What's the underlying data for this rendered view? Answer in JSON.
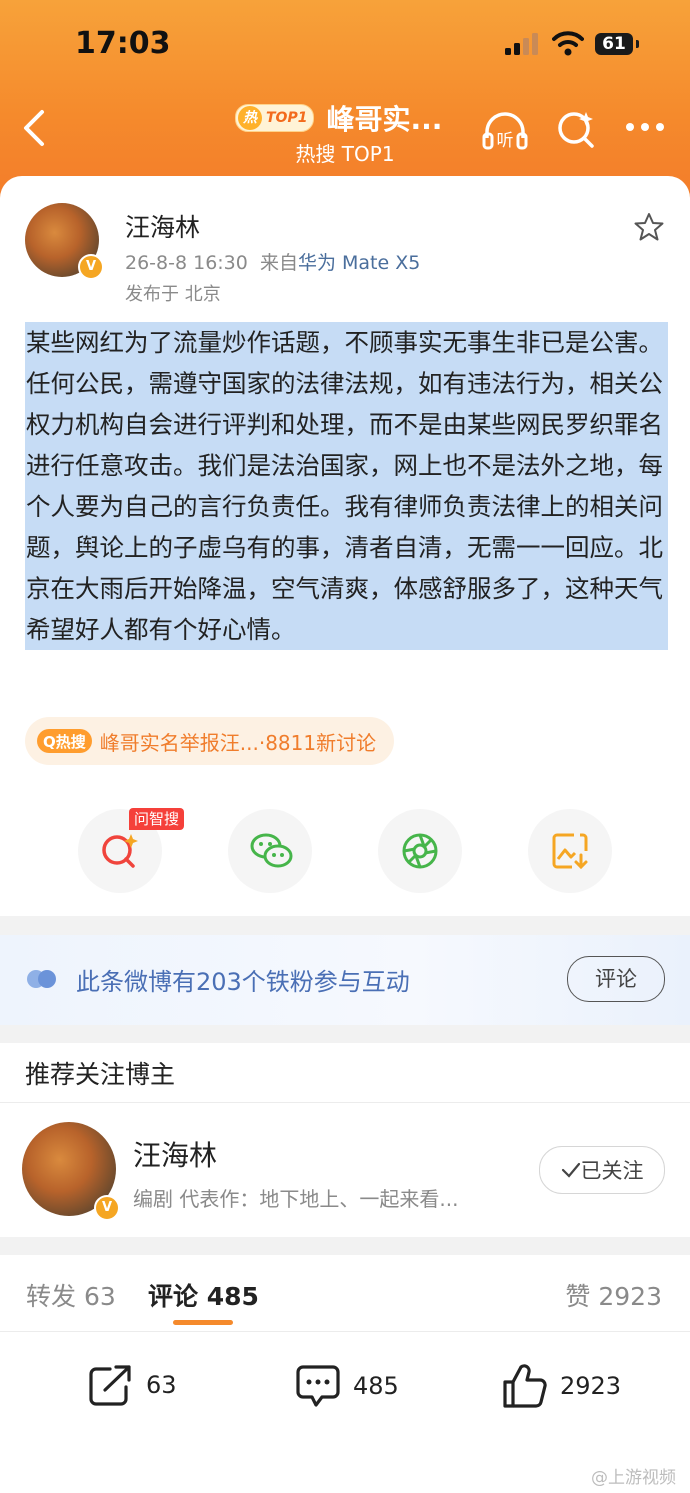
{
  "status_bar": {
    "time": "17:03",
    "battery": "61"
  },
  "nav": {
    "hot_badge": "热",
    "hot_rank": "TOP1",
    "title": "峰哥实...",
    "subtitle": "热搜 TOP1",
    "icons": [
      "back-arrow-icon",
      "headphones-listen-icon",
      "ai-search-icon",
      "more-icon"
    ]
  },
  "post": {
    "author": "汪海林",
    "date": "26-8-8 16:30",
    "source_prefix": "来自",
    "source_device": "华为 Mate X5",
    "location": "发布于 北京",
    "text": "某些网红为了流量炒作话题，不顾事实无事生非已是公害。任何公民，需遵守国家的法律法规，如有违法行为，相关公权力机构自会进行评判和处理，而不是由某些网民罗织罪名进行任意攻击。我们是法治国家，网上也不是法外之地，每个人要为自己的言行负责任。我有律师负责法律上的相关问题，舆论上的子虚乌有的事，清者自清，无需一一回应。北京在大雨后开始降温，空气清爽，体感舒服多了，这种天气希望好人都有个好心情。",
    "topic_tag": "Q热搜",
    "topic": "峰哥实名举报汪...·8811新讨论",
    "share_ai_tag": "问智搜",
    "share_icons": [
      "ai-search-icon",
      "wechat-icon",
      "moments-icon",
      "save-image-icon"
    ]
  },
  "fans": {
    "text": "此条微博有203个铁粉参与互动",
    "button": "评论"
  },
  "recommend": {
    "heading": "推荐关注博主",
    "name": "汪海林",
    "desc": "编剧  代表作：地下地上、一起来看...",
    "follow": "已关注"
  },
  "tabs": {
    "repost": "转发 63",
    "comment": "评论 485",
    "like": "赞 2923"
  },
  "actions": {
    "repost": "63",
    "comment": "485",
    "like": "2923"
  },
  "watermark": "@上游视频",
  "colors": {
    "header_orange": "#f58a2c",
    "highlight_blue": "#c6dcf5",
    "topic_orange": "#f07d2c",
    "link_blue": "#4a6fb5"
  }
}
